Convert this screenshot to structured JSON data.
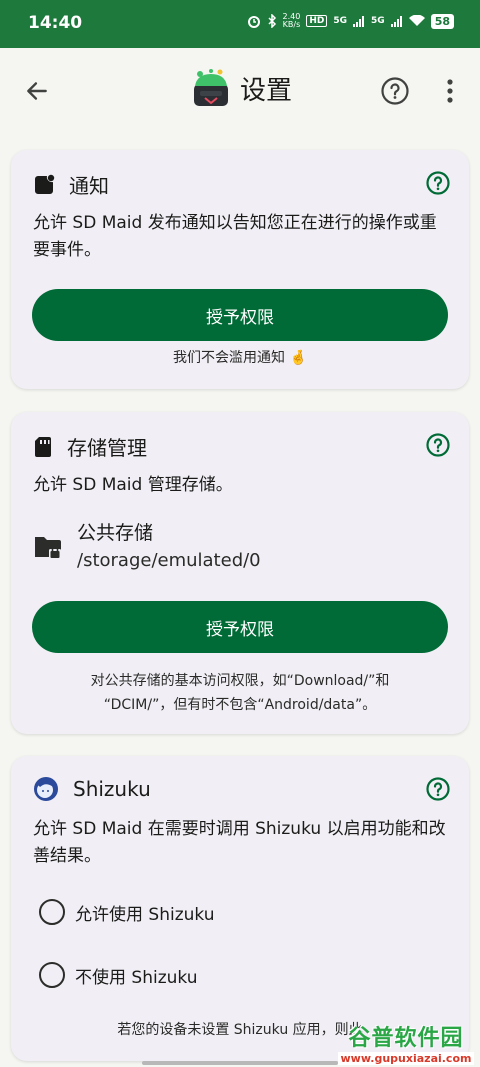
{
  "status_bar": {
    "time": "14:40",
    "net_speed_top": "2.40",
    "net_speed_bottom": "KB/s",
    "hd": "HD",
    "signal1": "5G",
    "signal2": "5G",
    "battery": "58"
  },
  "app_bar": {
    "title": "设置"
  },
  "cards": {
    "notification": {
      "title": "通知",
      "description": "允许 SD Maid 发布通知以告知您正在进行的操作或重要事件。",
      "button": "授予权限",
      "note": "我们不会滥用通知 🤞"
    },
    "storage": {
      "title": "存储管理",
      "description": "允许 SD Maid 管理存储。",
      "public_storage_label": "公共存储",
      "public_storage_path": "/storage/emulated/0",
      "button": "授予权限",
      "note_line1": "对公共存储的基本访问权限，如“Download/”和",
      "note_line2": "“DCIM/”，但有时不包含“Android/data”。"
    },
    "shizuku": {
      "title": "Shizuku",
      "description": "允许 SD Maid 在需要时调用 Shizuku 以启用功能和改善结果。",
      "option_allow": "允许使用 Shizuku",
      "option_deny": "不使用 Shizuku",
      "note": "若您的设备未设置 Shizuku 应用，则此"
    }
  },
  "watermark": {
    "main": "谷普软件园",
    "sub": "www.gupuxiazai.com"
  },
  "colors": {
    "status_bar": "#1d7a3c",
    "primary": "#006b36",
    "card": "#f1eff5",
    "background": "#f5f6f2"
  }
}
